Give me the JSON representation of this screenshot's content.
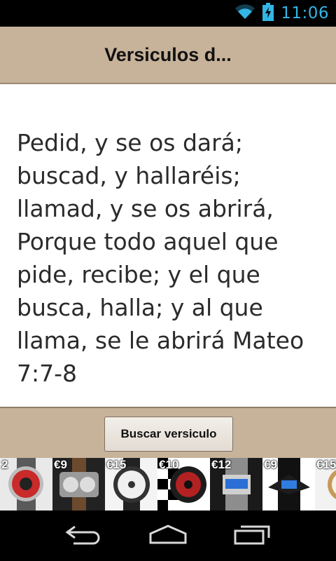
{
  "status_bar": {
    "time": "11:06"
  },
  "app_bar": {
    "title": "Versiculos d..."
  },
  "verse": {
    "text": "Pedid, y se os dará; buscad, y hallaréis; llamad, y se os abrirá, Porque todo aquel que pide, recibe; y el que busca, halla; y al que llama, se le abrirá Mateo 7:7-8"
  },
  "footer": {
    "search_button_label": "Buscar versiculo"
  },
  "ads": [
    {
      "price": "2"
    },
    {
      "price": "€9"
    },
    {
      "price": "€15"
    },
    {
      "price": "€10"
    },
    {
      "price": "€12"
    },
    {
      "price": "€9"
    },
    {
      "price": "€15"
    }
  ],
  "colors": {
    "accent": "#33b5e5",
    "bar": "#c7b29a"
  }
}
